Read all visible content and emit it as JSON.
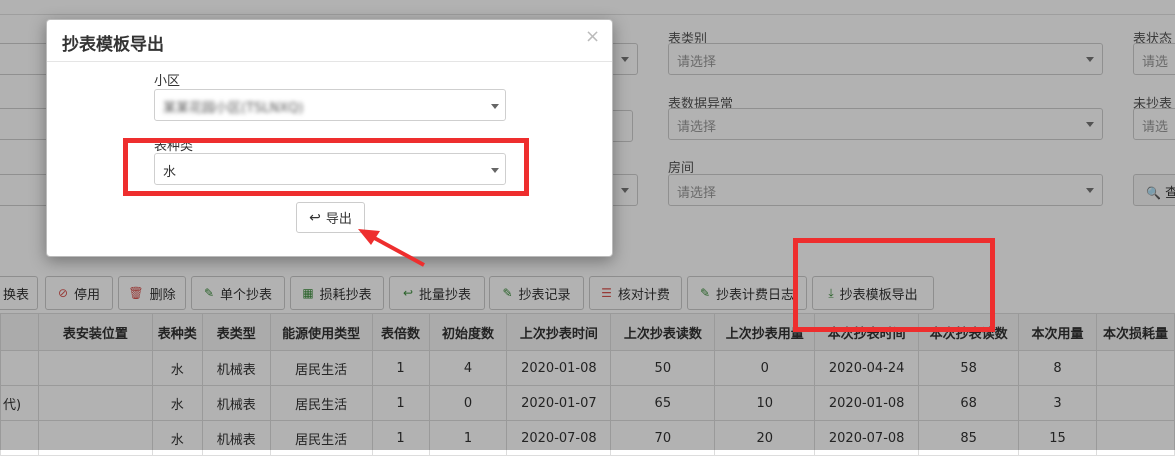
{
  "filters": {
    "col2": [
      {
        "label": "表类别",
        "placeholder": "请选择"
      },
      {
        "label": "表数据异常",
        "placeholder": "请选择"
      },
      {
        "label": "房间",
        "placeholder": "请选择"
      }
    ],
    "col3": [
      {
        "label": "表状态",
        "placeholder": "请选"
      },
      {
        "label": "未抄表",
        "placeholder": "请选"
      }
    ],
    "search_label": "查"
  },
  "toolbar": {
    "buttons": [
      {
        "label": "换表",
        "icon": "swap-icon"
      },
      {
        "label": "停用",
        "icon": "ban-icon"
      },
      {
        "label": "删除",
        "icon": "trash-icon"
      },
      {
        "label": "单个抄表",
        "icon": "edit-icon"
      },
      {
        "label": "损耗抄表",
        "icon": "calculator-icon"
      },
      {
        "label": "批量抄表",
        "icon": "reply-all-icon"
      },
      {
        "label": "抄表记录",
        "icon": "pencil-square-icon"
      },
      {
        "label": "核对计费",
        "icon": "list-icon"
      },
      {
        "label": "抄表计费日志",
        "icon": "pencil-square-icon"
      },
      {
        "label": "抄表模板导出",
        "icon": "download-icon"
      }
    ],
    "accent": "#e02020"
  },
  "table": {
    "columns": [
      "",
      "表安装位置",
      "表种类",
      "表类型",
      "能源使用类型",
      "表倍数",
      "初始度数",
      "上次抄表时间",
      "上次抄表读数",
      "上次抄表用量",
      "本次抄表时间",
      "本次抄表读数",
      "本次用量",
      "本次损耗量"
    ],
    "rows": [
      [
        "",
        "",
        "水",
        "机械表",
        "居民生活",
        "1",
        "4",
        "2020-01-08",
        "50",
        "0",
        "2020-04-24",
        "58",
        "8",
        ""
      ],
      [
        "代)",
        "",
        "水",
        "机械表",
        "居民生活",
        "1",
        "0",
        "2020-01-07",
        "65",
        "10",
        "2020-01-08",
        "68",
        "3",
        ""
      ],
      [
        "",
        "",
        "水",
        "机械表",
        "居民生活",
        "1",
        "1",
        "2020-07-08",
        "70",
        "20",
        "2020-07-08",
        "85",
        "15",
        ""
      ]
    ]
  },
  "modal": {
    "title": "抄表模板导出",
    "close": "×",
    "community_label": "小区",
    "community_value": "某某花园小区(TSLNXQ)",
    "meter_kind_label": "表种类",
    "meter_kind_value": "水",
    "export_label": "导出",
    "export_icon": "reply-icon"
  },
  "annotation_color": "#ee2e2e"
}
